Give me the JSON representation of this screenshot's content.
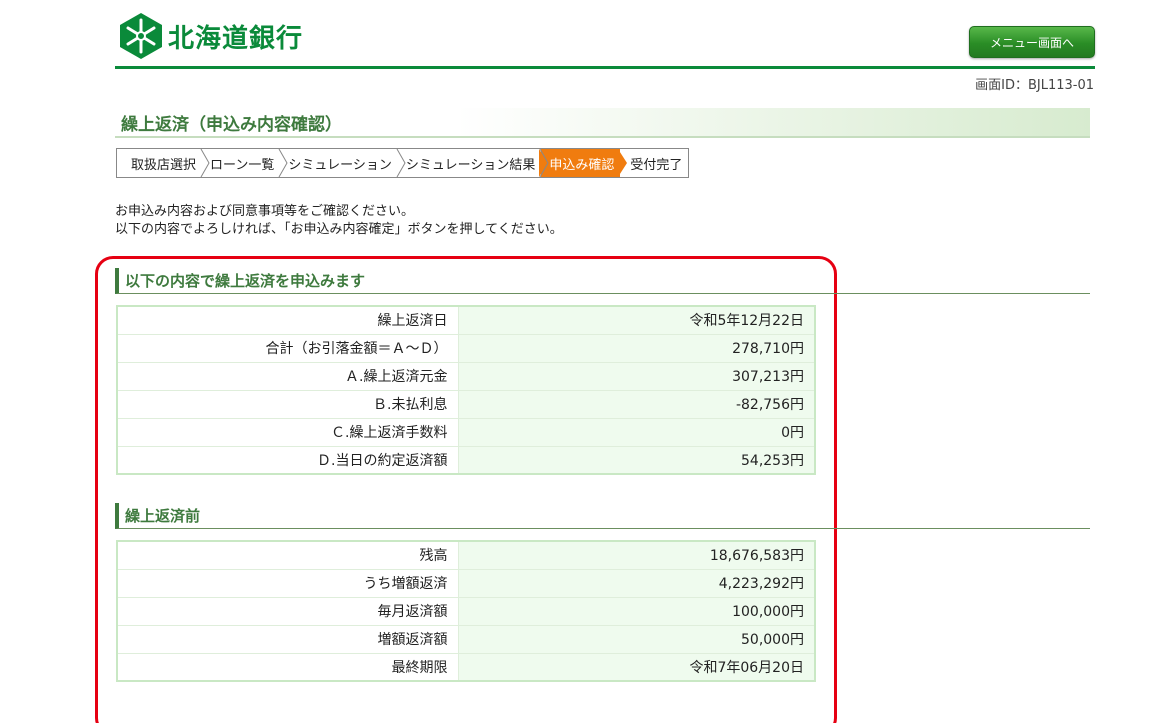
{
  "header": {
    "bank_name": "北海道銀行",
    "menu_button": "メニュー画面へ",
    "screen_id": "画面ID：BJL113-01",
    "brand_color": "#0a8a3a"
  },
  "page": {
    "title": "繰上返済（申込み内容確認）"
  },
  "steps": [
    {
      "label": "取扱店選択",
      "active": false
    },
    {
      "label": "ローン一覧",
      "active": false
    },
    {
      "label": "シミュレーション",
      "active": false
    },
    {
      "label": "シミュレーション結果",
      "active": false
    },
    {
      "label": "申込み確認",
      "active": true
    },
    {
      "label": "受付完了",
      "active": false
    }
  ],
  "intro": {
    "line1": "お申込み内容および同意事項等をご確認ください。",
    "line2": "以下の内容でよろしければ、「お申込み内容確定」ボタンを押してください。"
  },
  "section1": {
    "title": "以下の内容で繰上返済を申込みます",
    "rows": [
      {
        "label": "繰上返済日",
        "value": "令和5年12月22日"
      },
      {
        "label": "合計（お引落金額＝Ａ～Ｄ）",
        "value": "278,710円"
      },
      {
        "label": "Ａ.繰上返済元金",
        "value": "307,213円"
      },
      {
        "label": "Ｂ.未払利息",
        "value": "-82,756円"
      },
      {
        "label": "Ｃ.繰上返済手数料",
        "value": "0円"
      },
      {
        "label": "Ｄ.当日の約定返済額",
        "value": "54,253円"
      }
    ]
  },
  "section2": {
    "title": "繰上返済前",
    "rows": [
      {
        "label": "残高",
        "value": "18,676,583円"
      },
      {
        "label": "うち増額返済",
        "value": "4,223,292円"
      },
      {
        "label": "毎月返済額",
        "value": "100,000円"
      },
      {
        "label": "増額返済額",
        "value": "50,000円"
      },
      {
        "label": "最終期限",
        "value": "令和7年06月20日"
      }
    ]
  }
}
